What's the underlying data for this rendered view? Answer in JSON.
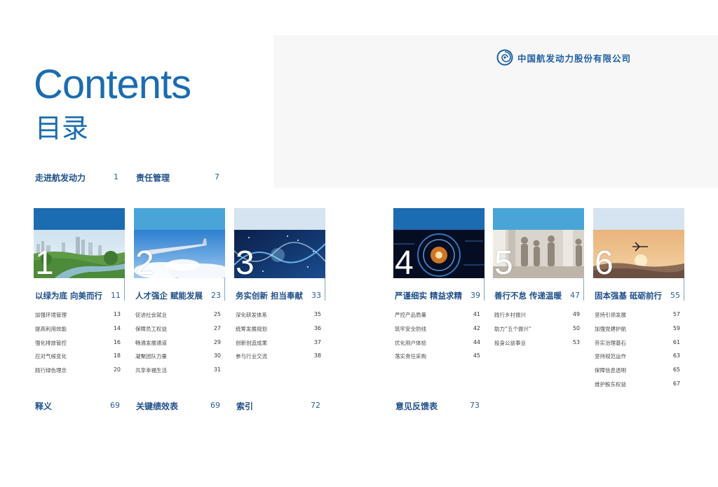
{
  "company_name": "中国航发动力股份有限公司",
  "title_en": "Contents",
  "title_zh": "目录",
  "top_entries": [
    {
      "label": "走进航发动力",
      "page": "1"
    },
    {
      "label": "责任管理",
      "page": "7"
    }
  ],
  "chapters": [
    {
      "number": "1",
      "title": "以绿为底 向美而行",
      "page": "11",
      "band_color": "#1b6cb0",
      "items": [
        {
          "label": "加强环境管理",
          "page": "13"
        },
        {
          "label": "提高利用效能",
          "page": "14"
        },
        {
          "label": "强化排放管控",
          "page": "16"
        },
        {
          "label": "应对气候变化",
          "page": "18"
        },
        {
          "label": "践行绿色理念",
          "page": "20"
        }
      ]
    },
    {
      "number": "2",
      "title": "人才强企 赋能发展",
      "page": "23",
      "band_color": "#49a5d8",
      "items": [
        {
          "label": "促进社会就业",
          "page": "25"
        },
        {
          "label": "保障员工权益",
          "page": "27"
        },
        {
          "label": "畅通发展通道",
          "page": "29"
        },
        {
          "label": "凝聚团队力量",
          "page": "30"
        },
        {
          "label": "共享幸福生活",
          "page": "31"
        }
      ]
    },
    {
      "number": "3",
      "title": "务实创新 担当奉献",
      "page": "33",
      "band_color": "#d6e3f0",
      "items": [
        {
          "label": "深化研发体系",
          "page": "35"
        },
        {
          "label": "统筹发展规划",
          "page": "36"
        },
        {
          "label": "创新创造成果",
          "page": "37"
        },
        {
          "label": "参与行业交流",
          "page": "38"
        }
      ]
    },
    {
      "number": "4",
      "title": "严谨细实 精益求精",
      "page": "39",
      "band_color": "#1b6cb0",
      "items": [
        {
          "label": "严控产品质量",
          "page": "41"
        },
        {
          "label": "筑牢安全防线",
          "page": "42"
        },
        {
          "label": "优化用户体验",
          "page": "44"
        },
        {
          "label": "落实责任采购",
          "page": "45"
        }
      ]
    },
    {
      "number": "5",
      "title": "善行不怠 传递温暖",
      "page": "47",
      "band_color": "#49a5d8",
      "items": [
        {
          "label": "践行乡村振兴",
          "page": "49"
        },
        {
          "label": "助力“五个振兴”",
          "page": "50"
        },
        {
          "label": "投身公益事业",
          "page": "53"
        }
      ]
    },
    {
      "number": "6",
      "title": "固本强基 砥砺前行",
      "page": "55",
      "band_color": "#d6e3f0",
      "items": [
        {
          "label": "坚持引领发展",
          "page": "57"
        },
        {
          "label": "加强党建护航",
          "page": "59"
        },
        {
          "label": "夯实治理基石",
          "page": "61"
        },
        {
          "label": "坚持规范运作",
          "page": "63"
        },
        {
          "label": "保障信息透明",
          "page": "65"
        },
        {
          "label": "维护股东权益",
          "page": "67"
        }
      ]
    }
  ],
  "bottom_entries": [
    {
      "label": "释义",
      "page": "69"
    },
    {
      "label": "关键绩效表",
      "page": "69"
    },
    {
      "label": "索引",
      "page": "72"
    },
    {
      "label": "意见反馈表",
      "page": "73"
    }
  ]
}
